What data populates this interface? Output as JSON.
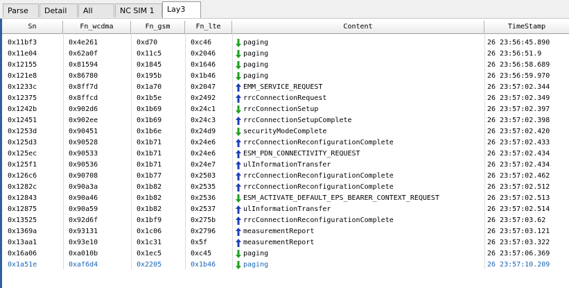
{
  "tabs": [
    {
      "label": "Parse"
    },
    {
      "label": "Detail"
    },
    {
      "label": "All"
    },
    {
      "label": "NC SIM 1"
    },
    {
      "label": "Lay3"
    }
  ],
  "columns": [
    {
      "label": "Sn"
    },
    {
      "label": "Fn_wcdma"
    },
    {
      "label": "Fn_gsm"
    },
    {
      "label": "Fn_lte"
    },
    {
      "label": "Content"
    },
    {
      "label": "TimeStamp"
    }
  ],
  "icons": {
    "down": "down-arrow-icon-green",
    "up": "up-arrow-icon-blue"
  },
  "colors": {
    "down": "#1fa01f",
    "up": "#1a3fb4",
    "selected_text": "#1a64b4",
    "border": "#2f5f9f"
  },
  "rows": [
    {
      "sn": "0x11bf3",
      "wcdma": "0x4e261",
      "gsm": "0xd70",
      "lte": "0xc46",
      "dir": "down",
      "content": "paging",
      "ts": "26 23:56:45.890"
    },
    {
      "sn": "0x11e04",
      "wcdma": "0x62a0f",
      "gsm": "0x11c5",
      "lte": "0x2046",
      "dir": "down",
      "content": "paging",
      "ts": "26 23:56:51.9"
    },
    {
      "sn": "0x12155",
      "wcdma": "0x81594",
      "gsm": "0x1845",
      "lte": "0x1646",
      "dir": "down",
      "content": "paging",
      "ts": "26 23:56:58.689"
    },
    {
      "sn": "0x121e8",
      "wcdma": "0x86780",
      "gsm": "0x195b",
      "lte": "0x1b46",
      "dir": "down",
      "content": "paging",
      "ts": "26 23:56:59.970"
    },
    {
      "sn": "0x1233c",
      "wcdma": "0x8ff7d",
      "gsm": "0x1a70",
      "lte": "0x2047",
      "dir": "up",
      "content": "EMM_SERVICE_REQUEST",
      "ts": "26 23:57:02.344"
    },
    {
      "sn": "0x12375",
      "wcdma": "0x8ffcd",
      "gsm": "0x1b5e",
      "lte": "0x2492",
      "dir": "up",
      "content": "rrcConnectionRequest",
      "ts": "26 23:57:02.349"
    },
    {
      "sn": "0x1242b",
      "wcdma": "0x902d6",
      "gsm": "0x1b69",
      "lte": "0x24c1",
      "dir": "down",
      "content": "rrcConnectionSetup",
      "ts": "26 23:57:02.397"
    },
    {
      "sn": "0x12451",
      "wcdma": "0x902ee",
      "gsm": "0x1b69",
      "lte": "0x24c3",
      "dir": "up",
      "content": "rrcConnectionSetupComplete",
      "ts": "26 23:57:02.398"
    },
    {
      "sn": "0x1253d",
      "wcdma": "0x90451",
      "gsm": "0x1b6e",
      "lte": "0x24d9",
      "dir": "down",
      "content": "securityModeComplete",
      "ts": "26 23:57:02.420"
    },
    {
      "sn": "0x125d3",
      "wcdma": "0x90528",
      "gsm": "0x1b71",
      "lte": "0x24e6",
      "dir": "up",
      "content": "rrcConnectionReconfigurationComplete",
      "ts": "26 23:57:02.433"
    },
    {
      "sn": "0x125ec",
      "wcdma": "0x90533",
      "gsm": "0x1b71",
      "lte": "0x24e6",
      "dir": "up",
      "content": "ESM_PDN_CONNECTIVITY_REQUEST",
      "ts": "26 23:57:02.434"
    },
    {
      "sn": "0x125f1",
      "wcdma": "0x90536",
      "gsm": "0x1b71",
      "lte": "0x24e7",
      "dir": "up",
      "content": "ulInformationTransfer",
      "ts": "26 23:57:02.434"
    },
    {
      "sn": "0x126c6",
      "wcdma": "0x90708",
      "gsm": "0x1b77",
      "lte": "0x2503",
      "dir": "up",
      "content": "rrcConnectionReconfigurationComplete",
      "ts": "26 23:57:02.462"
    },
    {
      "sn": "0x1282c",
      "wcdma": "0x90a3a",
      "gsm": "0x1b82",
      "lte": "0x2535",
      "dir": "up",
      "content": "rrcConnectionReconfigurationComplete",
      "ts": "26 23:57:02.512"
    },
    {
      "sn": "0x12843",
      "wcdma": "0x90a46",
      "gsm": "0x1b82",
      "lte": "0x2536",
      "dir": "down",
      "content": "ESM_ACTIVATE_DEFAULT_EPS_BEARER_CONTEXT_REQUEST",
      "ts": "26 23:57:02.513"
    },
    {
      "sn": "0x12875",
      "wcdma": "0x90a59",
      "gsm": "0x1b82",
      "lte": "0x2537",
      "dir": "up",
      "content": "ulInformationTransfer",
      "ts": "26 23:57:02.514"
    },
    {
      "sn": "0x13525",
      "wcdma": "0x92d6f",
      "gsm": "0x1bf9",
      "lte": "0x275b",
      "dir": "up",
      "content": "rrcConnectionReconfigurationComplete",
      "ts": "26 23:57:03.62"
    },
    {
      "sn": "0x1369a",
      "wcdma": "0x93131",
      "gsm": "0x1c06",
      "lte": "0x2796",
      "dir": "up",
      "content": "measurementReport",
      "ts": "26 23:57:03.121"
    },
    {
      "sn": "0x13aa1",
      "wcdma": "0x93e10",
      "gsm": "0x1c31",
      "lte": "0x5f",
      "dir": "up",
      "content": "measurementReport",
      "ts": "26 23:57:03.322"
    },
    {
      "sn": "0x16a06",
      "wcdma": "0xa010b",
      "gsm": "0x1ec5",
      "lte": "0xc45",
      "dir": "down",
      "content": "paging",
      "ts": "26 23:57:06.369"
    },
    {
      "sn": "0x1a51e",
      "wcdma": "0xaf6d4",
      "gsm": "0x2205",
      "lte": "0x1b46",
      "dir": "down",
      "content": "paging",
      "ts": "26 23:57:10.209",
      "selected": true
    }
  ]
}
